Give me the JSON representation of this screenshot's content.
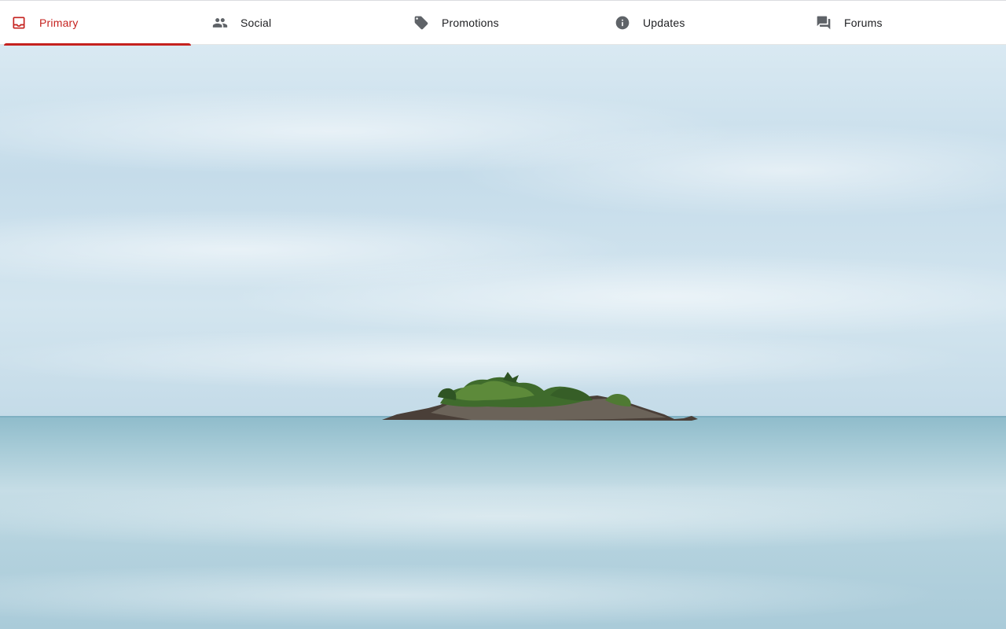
{
  "tabs": [
    {
      "label": "Primary",
      "icon": "inbox-icon",
      "active": true
    },
    {
      "label": "Social",
      "icon": "people-icon",
      "active": false
    },
    {
      "label": "Promotions",
      "icon": "tag-icon",
      "active": false
    },
    {
      "label": "Updates",
      "icon": "info-icon",
      "active": false
    },
    {
      "label": "Forums",
      "icon": "forum-icon",
      "active": false
    }
  ],
  "colors": {
    "accent": "#c5221f",
    "icon_gray": "#5f6368",
    "sky": "#cfe3ef",
    "sea": "#a9ccd8"
  }
}
